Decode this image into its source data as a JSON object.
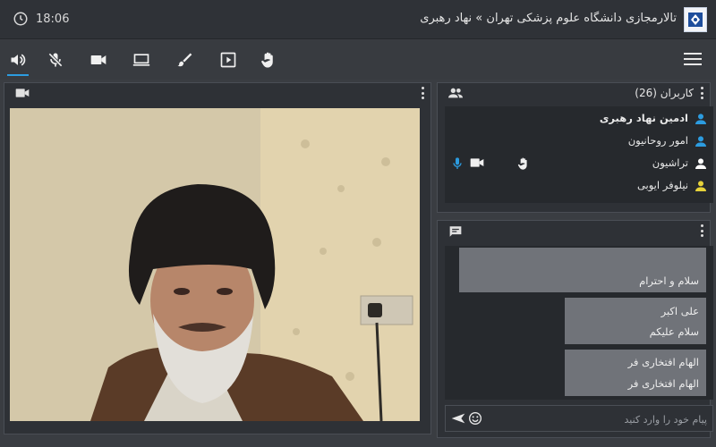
{
  "header": {
    "time": "18:06",
    "title": "تالارمجازی دانشگاه علوم پزشکی تهران » نهاد رهبری"
  },
  "toolbar": {
    "tools": [
      "speaker-icon",
      "mic-off-icon",
      "camera-icon",
      "screen-share-icon",
      "brush-icon",
      "play-icon",
      "raise-hand-icon"
    ],
    "accent": "#2c9ce0"
  },
  "users": {
    "title": "کاربران (26)",
    "items": [
      {
        "name": "ادمین نهاد رهبری",
        "icon_color": "#2c9ce0"
      },
      {
        "name": "امور روحانیون",
        "icon_color": "#2c9ce0"
      },
      {
        "name": "تراشیون",
        "icon_color": "#ffffff"
      },
      {
        "name": "نیلوفر ایوبی",
        "icon_color": "#e6d23a"
      }
    ]
  },
  "chat": {
    "messages": [
      {
        "lines": [
          "سلام و احترام"
        ]
      },
      {
        "lines": [
          "علی اکبر",
          "سلام علیکم"
        ]
      },
      {
        "lines": [
          "الهام افتخاری فر",
          "الهام افتخاری فر"
        ]
      }
    ],
    "placeholder": "پیام خود را وارد کنید"
  }
}
